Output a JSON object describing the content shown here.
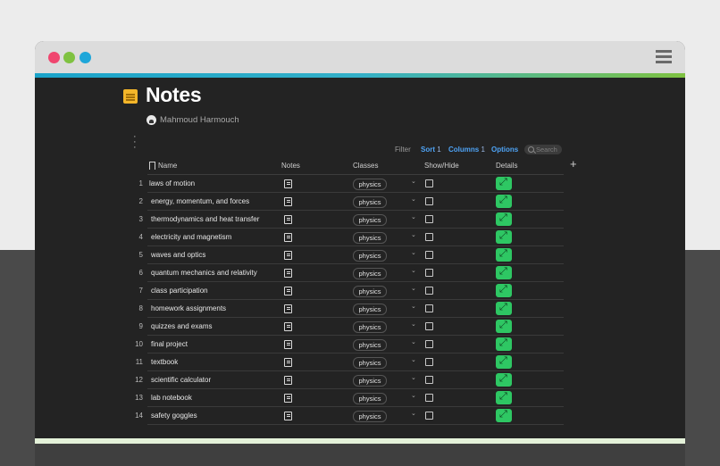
{
  "page": {
    "title": "Notes",
    "author": "Mahmoud Harmouch"
  },
  "toolbar": {
    "filter": "Filter",
    "sort_label": "Sort",
    "sort_count": "1",
    "columns_label": "Columns",
    "columns_count": "1",
    "options": "Options",
    "search_placeholder": "Search"
  },
  "columns": {
    "name": "Name",
    "notes": "Notes",
    "classes": "Classes",
    "show_hide": "Show/Hide",
    "details": "Details"
  },
  "rows": [
    {
      "num": "1",
      "name": "laws of motion",
      "class": "physics"
    },
    {
      "num": "2",
      "name": "energy, momentum, and forces",
      "class": "physics"
    },
    {
      "num": "3",
      "name": "thermodynamics and heat transfer",
      "class": "physics"
    },
    {
      "num": "4",
      "name": "electricity and magnetism",
      "class": "physics"
    },
    {
      "num": "5",
      "name": "waves and optics",
      "class": "physics"
    },
    {
      "num": "6",
      "name": "quantum mechanics and relativity",
      "class": "physics"
    },
    {
      "num": "7",
      "name": "class participation",
      "class": "physics"
    },
    {
      "num": "8",
      "name": "homework assignments",
      "class": "physics"
    },
    {
      "num": "9",
      "name": "quizzes and exams",
      "class": "physics"
    },
    {
      "num": "10",
      "name": "final project",
      "class": "physics"
    },
    {
      "num": "11",
      "name": "textbook",
      "class": "physics"
    },
    {
      "num": "12",
      "name": "scientific calculator",
      "class": "physics"
    },
    {
      "num": "13",
      "name": "lab notebook",
      "class": "physics"
    },
    {
      "num": "14",
      "name": "safety goggles",
      "class": "physics"
    }
  ],
  "colors": {
    "accent_blue": "#1aa3c9",
    "accent_green": "#7fc241",
    "details_button": "#2ec763",
    "page_icon": "#f4b62a"
  },
  "icons": {
    "page": "notepad-icon",
    "notes": "note-icon",
    "details": "expand-icon",
    "add_column": "plus-icon"
  }
}
